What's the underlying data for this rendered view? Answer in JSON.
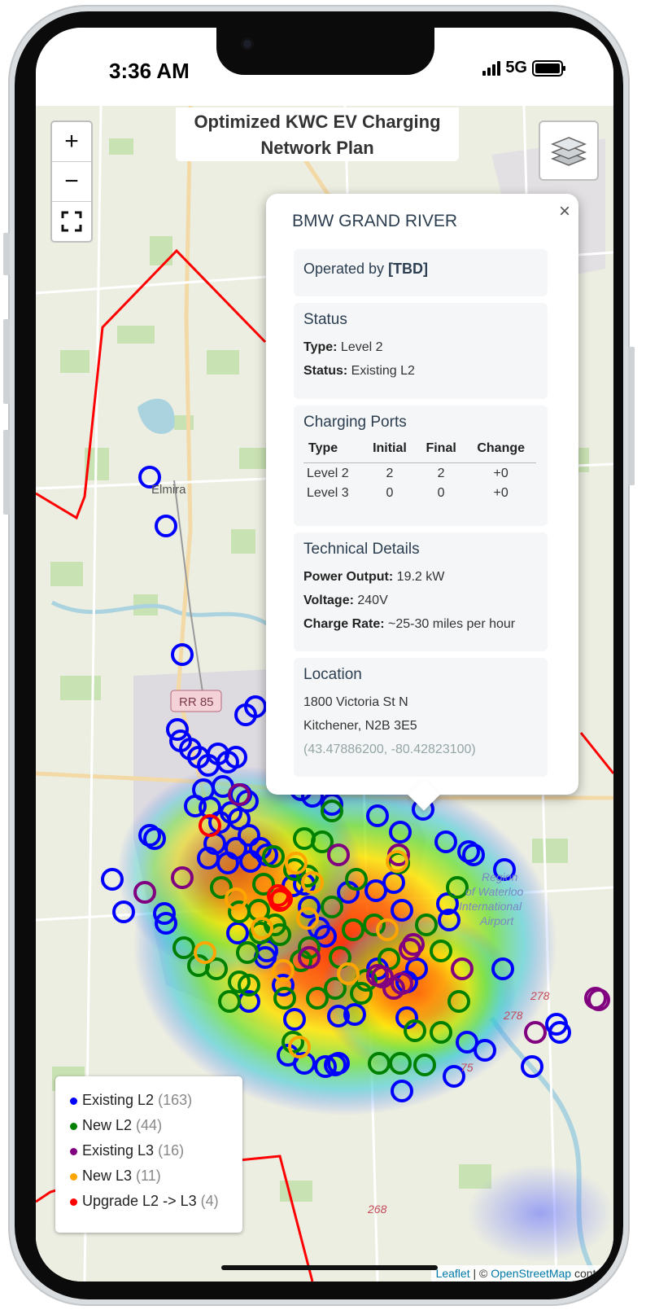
{
  "status_bar": {
    "time": "3:36 AM",
    "network": "5G"
  },
  "map": {
    "title": "Optimized KWC EV Charging Network Plan",
    "zoom_in": "+",
    "zoom_out": "−",
    "fullscreen": "⛶",
    "place_labels": {
      "elmira": "Elmira",
      "road_rr85": "RR 85",
      "airport": "Region of Waterloo International Airport",
      "road_278": "278",
      "road_278b": "278",
      "road_268": "268",
      "road_275": "75"
    },
    "colors": {
      "existing_l2": "#0000ff",
      "new_l2": "#008000",
      "existing_l3": "#800080",
      "new_l3": "#ffa500",
      "upgrade": "#ff0000",
      "boundary": "#ff0000"
    },
    "attribution": {
      "leaflet": "Leaflet",
      "sep": " | © ",
      "osm": "OpenStreetMap",
      "rest": " contrib"
    }
  },
  "popup": {
    "close": "×",
    "title": "BMW GRAND RIVER",
    "operator": {
      "prefix": "Operated by ",
      "value": "[TBD]"
    },
    "status": {
      "heading": "Status",
      "type_label": "Type:",
      "type_value": " Level 2",
      "status_label": "Status:",
      "status_value": " Existing L2"
    },
    "ports": {
      "heading": "Charging Ports",
      "columns": [
        "Type",
        "Initial",
        "Final",
        "Change"
      ],
      "rows": [
        [
          "Level 2",
          "2",
          "2",
          "+0"
        ],
        [
          "Level 3",
          "0",
          "0",
          "+0"
        ]
      ]
    },
    "technical": {
      "heading": "Technical Details",
      "power_label": "Power Output:",
      "power_value": " 19.2 kW",
      "voltage_label": "Voltage:",
      "voltage_value": " 240V",
      "rate_label": "Charge Rate:",
      "rate_value": " ~25-30 miles per hour"
    },
    "location": {
      "heading": "Location",
      "street": "1800 Victoria St N",
      "city": "Kitchener, N2B 3E5",
      "coords": "(43.47886200, -80.42823100)"
    }
  },
  "legend": {
    "items": [
      {
        "label": "Existing L2",
        "count": "(163)",
        "color": "#0000ff"
      },
      {
        "label": "New L2",
        "count": "(44)",
        "color": "#008000"
      },
      {
        "label": "Existing L3",
        "count": "(16)",
        "color": "#800080"
      },
      {
        "label": "New L3",
        "count": "(11)",
        "color": "#ffa500"
      },
      {
        "label": "Upgrade L2 -> L3",
        "count": "(4)",
        "color": "#ff0000"
      }
    ]
  }
}
